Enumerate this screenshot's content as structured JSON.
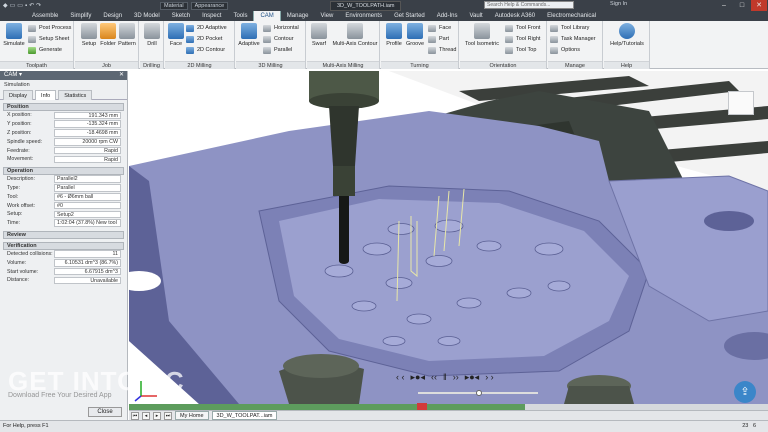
{
  "titlebar": {
    "material_label": "Material",
    "appearance_label": "Appearance",
    "filename": "3D_W_TOOLPATH.iam",
    "search_placeholder": "Search Help & Commands...",
    "user_label": "Sign In",
    "min": "–",
    "max": "□",
    "close": "✕"
  },
  "menu_tabs": [
    "Assemble",
    "Simplify",
    "Design",
    "3D Model",
    "Sketch",
    "Inspect",
    "Tools",
    "CAM",
    "Manage",
    "View",
    "Environments",
    "Get Started",
    "Add-Ins",
    "Vault",
    "Autodesk A360",
    "Electromechanical"
  ],
  "active_tab": "CAM",
  "ribbon": {
    "toolpath": {
      "label": "Toolpath",
      "simulate": "Simulate",
      "post_process": "Post Process",
      "setup_sheet": "Setup Sheet",
      "generate": "Generate"
    },
    "job": {
      "label": "Job",
      "setup": "Setup",
      "folder": "Folder",
      "pattern": "Pattern"
    },
    "drilling": {
      "label": "Drilling",
      "drill": "Drill"
    },
    "milling_2d": {
      "label": "2D Milling",
      "face": "Face",
      "adaptive_2d": "2D Adaptive",
      "pocket_2d": "2D Pocket",
      "contour_2d": "2D Contour"
    },
    "milling_3d": {
      "label": "3D Milling",
      "adaptive": "Adaptive",
      "horizontal": "Horizontal",
      "contour": "Contour",
      "parallel": "Parallel"
    },
    "multi_axis": {
      "label": "Multi-Axis Milling",
      "swarf": "Swarf",
      "multi_axis_contour": "Multi-Axis Contour"
    },
    "turning": {
      "label": "Turning",
      "profile": "Profile",
      "groove": "Groove",
      "face": "Face",
      "part": "Part",
      "thread": "Thread"
    },
    "orientation": {
      "label": "Orientation",
      "tool_isometric": "Tool Isometric",
      "tool_front": "Tool Front",
      "tool_right": "Tool Right",
      "tool_top": "Tool Top"
    },
    "manage": {
      "label": "Manage",
      "tool_library": "Tool Library",
      "task_manager": "Task Manager",
      "options": "Options"
    },
    "help": {
      "label": "Help",
      "help_tutorials": "Help/Tutorials"
    }
  },
  "panel": {
    "title": "CAM ▾",
    "subtitle": "Simulation",
    "tabs": [
      "Display",
      "Info",
      "Statistics"
    ],
    "active_tab": "Info",
    "position": {
      "title": "Position",
      "rows": [
        {
          "k": "X position:",
          "v": "191.343 mm"
        },
        {
          "k": "Y position:",
          "v": "-135.324 mm"
        },
        {
          "k": "Z position:",
          "v": "-18.4698 mm"
        },
        {
          "k": "Spindle speed:",
          "v": "20000 rpm CW"
        },
        {
          "k": "Feedrate:",
          "v": "Rapid"
        },
        {
          "k": "Movement:",
          "v": "Rapid"
        }
      ]
    },
    "operation": {
      "title": "Operation",
      "rows": [
        {
          "k": "Description:",
          "v": "Parallel2"
        },
        {
          "k": "Type:",
          "v": "Parallel"
        },
        {
          "k": "Tool:",
          "v": "#6 - Ø6mm ball"
        },
        {
          "k": "Work offset:",
          "v": "#0"
        },
        {
          "k": "Setup:",
          "v": "Setup2"
        },
        {
          "k": "Time:",
          "v": "1:02:04 (37.8%) New tool"
        }
      ]
    },
    "review": {
      "title": "Review"
    },
    "verification": {
      "title": "Verification",
      "rows": [
        {
          "k": "Detected collisions:",
          "v": "11"
        },
        {
          "k": "Volume:",
          "v": "6.10531 dm^3 (86.7%)"
        },
        {
          "k": "Start volume:",
          "v": "6.67915 dm^3"
        },
        {
          "k": "Distance:",
          "v": "Unavailable"
        }
      ]
    },
    "close_label": "Close"
  },
  "watermark": {
    "main": "GET INTO PC",
    "sub": "Download Free Your Desired App"
  },
  "playback": [
    "‹ ‹",
    "▸●◂",
    "‹‹",
    "‖",
    "››",
    "▸●◂",
    "› ›"
  ],
  "doctabs": {
    "home": "My Home",
    "file": "3D_W_TOOLPAT...iam",
    "page_a": "23",
    "page_b": "6"
  },
  "statusbar": {
    "text": "For Help, press F1",
    "num_a": "23",
    "num_b": "6"
  },
  "timeline": {
    "progress": 0.62,
    "marker_pos": 0.45,
    "scrubber": 0.48
  },
  "colors": {
    "stock": "#8e93c4",
    "stock_dark": "#5d6297",
    "accent": "#1d4f86",
    "spindle": "#4d5847"
  }
}
